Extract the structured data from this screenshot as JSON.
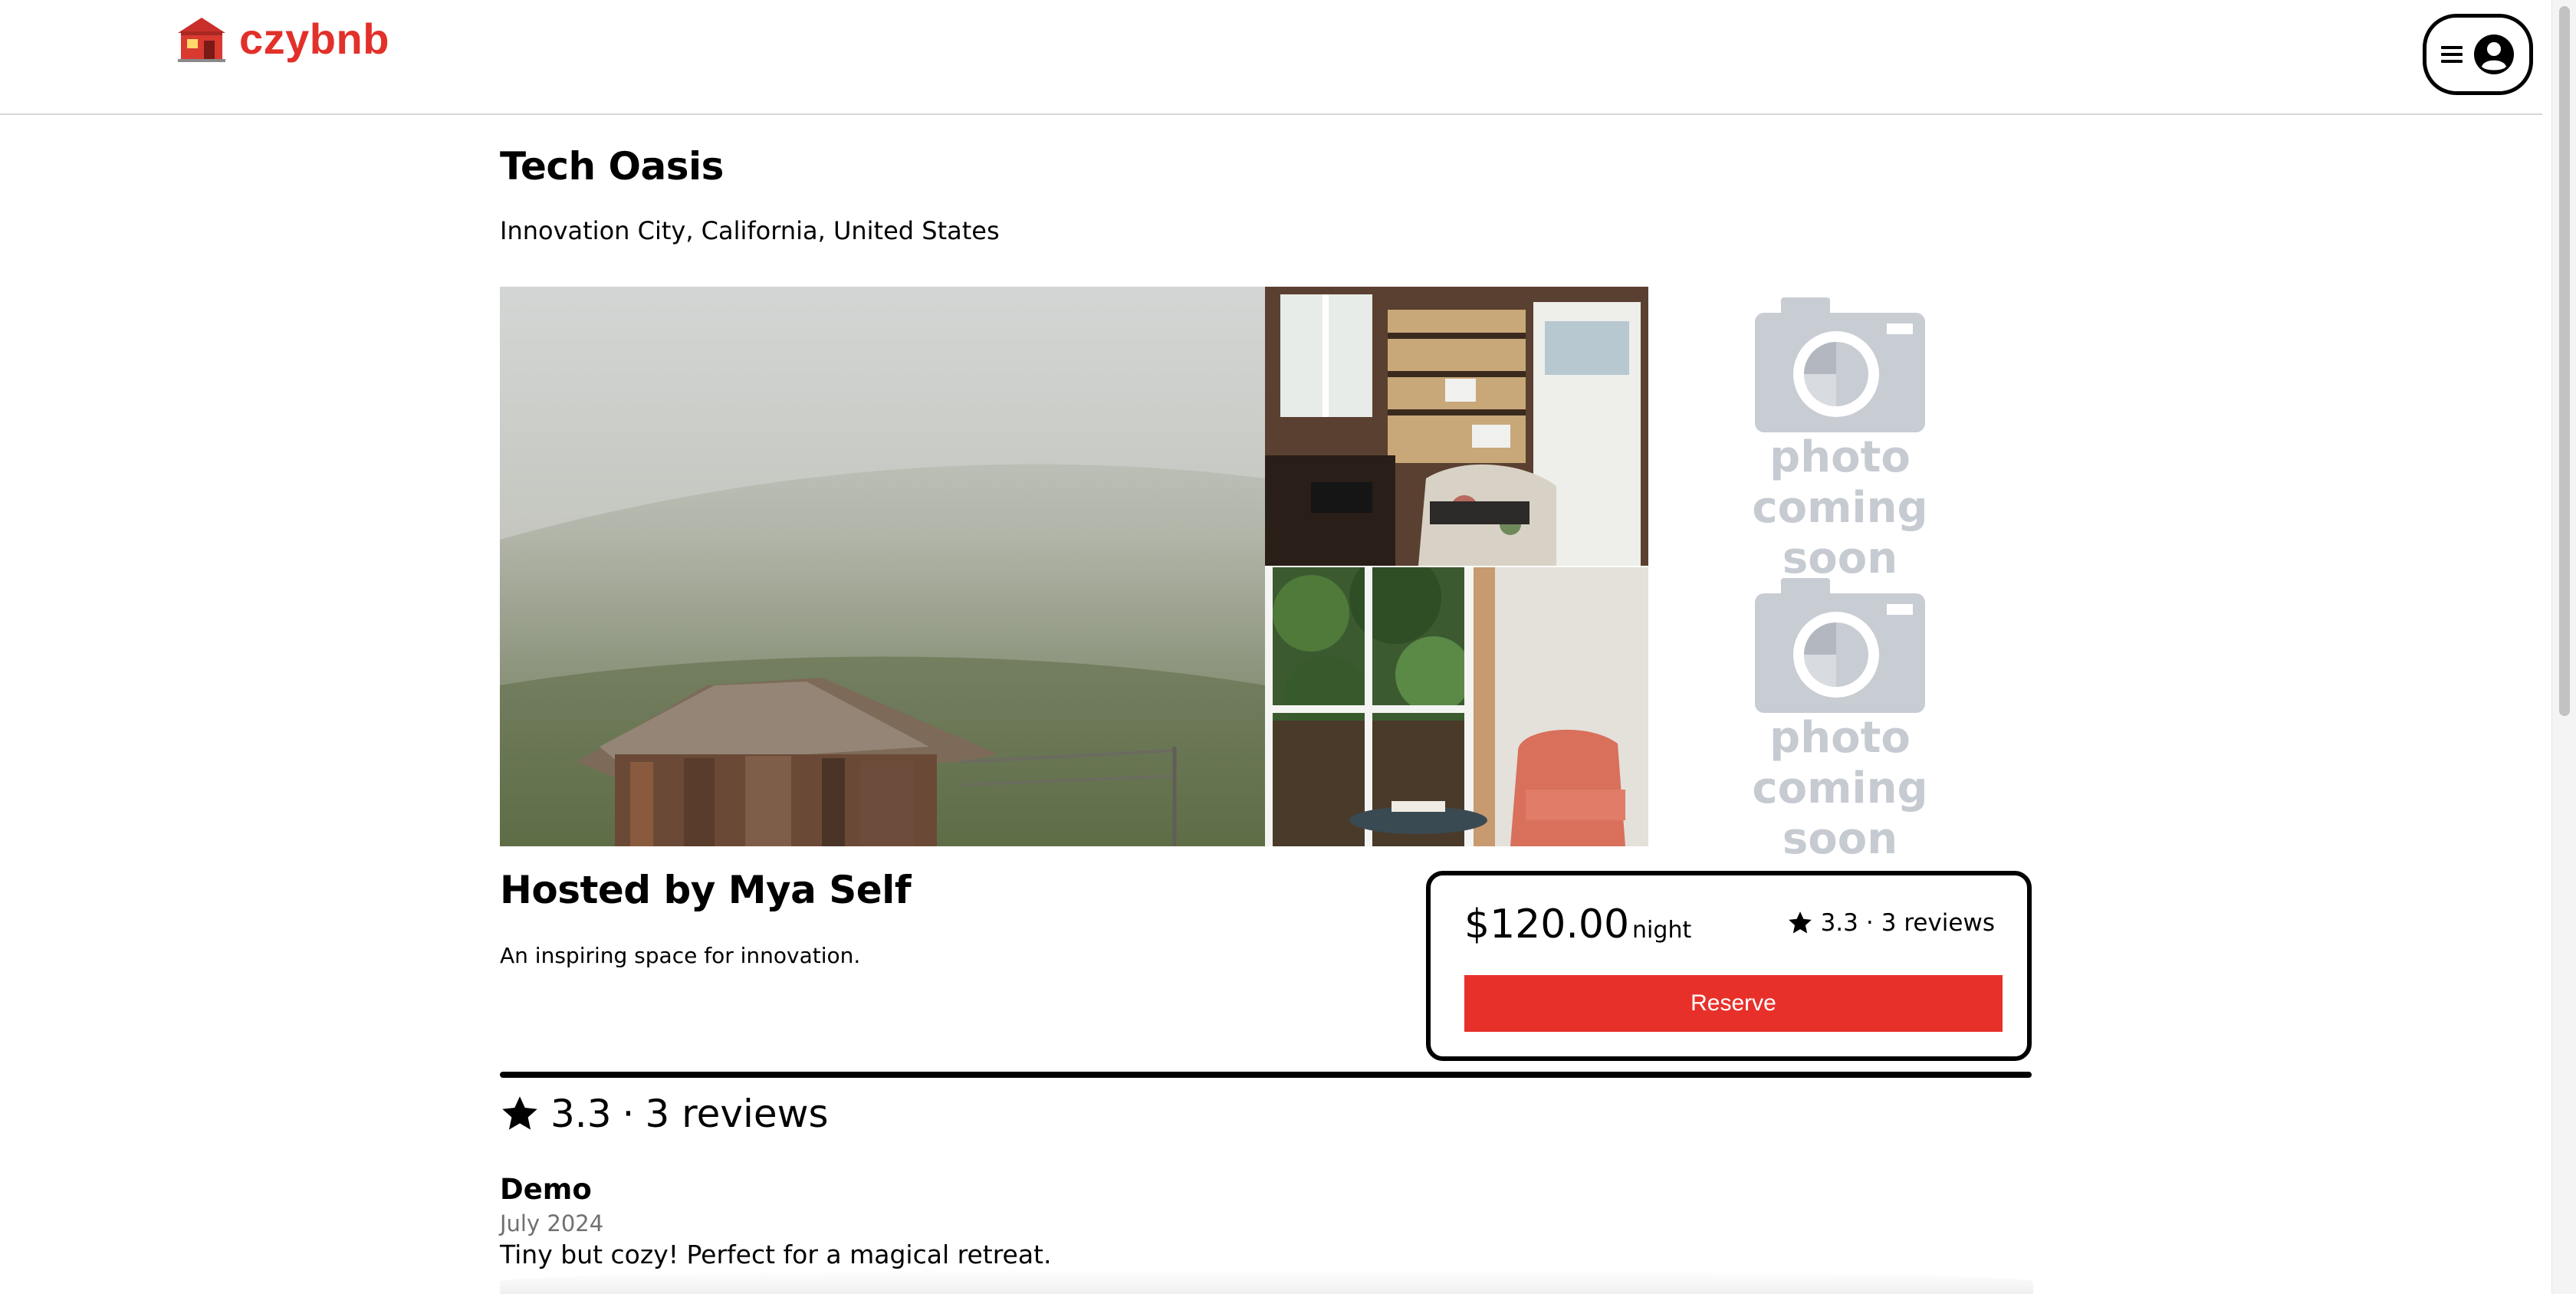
{
  "app": {
    "brand": "czybnb",
    "brand_color": "#e2302a"
  },
  "header": {
    "logo_icon": "house-icon",
    "menu_icon": "hamburger-menu-icon",
    "user_icon": "user-circle-icon"
  },
  "listing": {
    "title": "Tech Oasis",
    "location": "Innovation City, California, United States",
    "host": "Hosted by Mya Self",
    "description": "An inspiring space for innovation."
  },
  "gallery": {
    "placeholder_line1": "photo",
    "placeholder_line2": "coming soon",
    "photos": [
      "foggy-hillside-shack",
      "rustic-cabin-interior",
      "window-with-pink-armchair"
    ]
  },
  "booking": {
    "price": "$120.00",
    "per": "night",
    "rating": "3.3",
    "separator": "·",
    "review_count": "3 reviews",
    "reserve_label": "Reserve",
    "accent_color": "#e8302a"
  },
  "reviews": {
    "rating": "3.3",
    "separator": "·",
    "count_label": "3 reviews",
    "items": [
      {
        "author": "Demo",
        "date": "July 2024",
        "text": "Tiny but cozy! Perfect for a magical retreat."
      }
    ]
  }
}
